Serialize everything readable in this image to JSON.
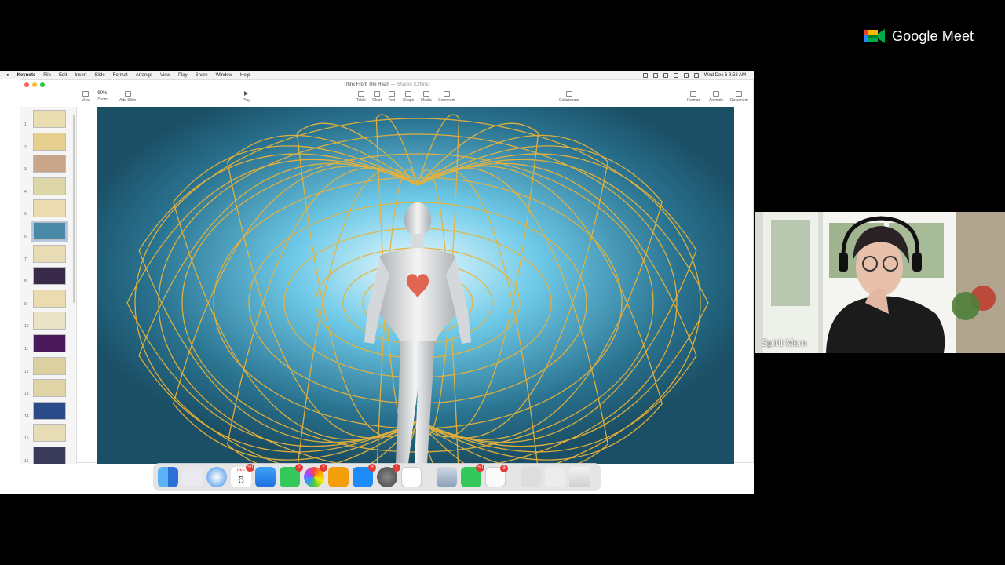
{
  "meet": {
    "brand": "Google Meet",
    "participant": {
      "name": "Spirit Mom"
    }
  },
  "mac": {
    "menubar": [
      "Keynote",
      "File",
      "Edit",
      "Insert",
      "Slide",
      "Format",
      "Arrange",
      "View",
      "Play",
      "Share",
      "Window",
      "Help"
    ],
    "clock": "Wed Dec 6  9:58 AM"
  },
  "keynote": {
    "doc_title": "Think From The Heart",
    "doc_status": "— Shared (Offline)",
    "zoom": "90%",
    "toolbar": {
      "view": "View",
      "zoom": "Zoom",
      "add_slide": "Add Slide",
      "play": "Play",
      "table": "Table",
      "chart": "Chart",
      "text": "Text",
      "shape": "Shape",
      "media": "Media",
      "comment": "Comment",
      "collaborate": "Collaborate",
      "format": "Format",
      "animate": "Animate",
      "document": "Document"
    },
    "slide_numbers": [
      "1",
      "2",
      "3",
      "4",
      "5",
      "6",
      "7",
      "8",
      "9",
      "10",
      "11",
      "12",
      "13",
      "14",
      "15",
      "16"
    ],
    "selected_slide": 6
  },
  "dock": {
    "calendar_day": "6",
    "calendar_month": "DEC",
    "badges": {
      "calendar": "50",
      "messages": "2",
      "photos": "2",
      "app_store": "8",
      "system_settings": "1",
      "facetime": "50",
      "reminders": "3"
    }
  },
  "colors": {
    "slide_bg": "#1f5a73",
    "glow": "#bfefff",
    "torus": "#e8b23a",
    "heart": "#e0553f"
  }
}
